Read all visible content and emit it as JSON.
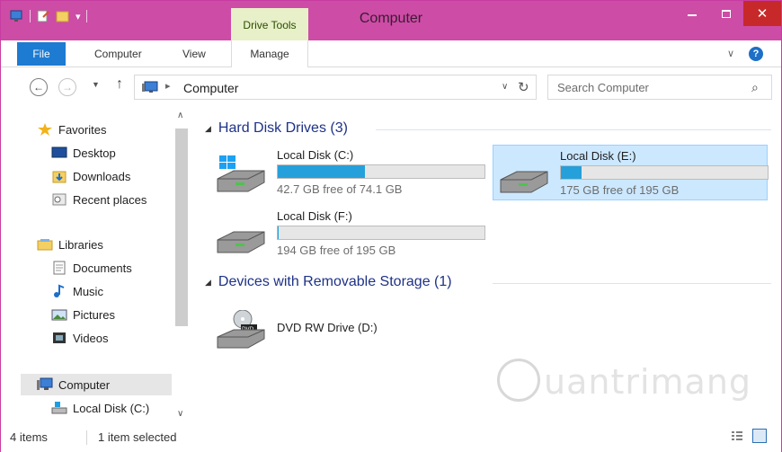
{
  "window": {
    "title": "Computer",
    "contextual_tab_group": "Drive Tools"
  },
  "ribbon": {
    "tabs": [
      "File",
      "Computer",
      "View",
      "Manage"
    ]
  },
  "address": {
    "path": "Computer",
    "search_placeholder": "Search Computer"
  },
  "sidebar": {
    "favorites": {
      "label": "Favorites",
      "items": [
        "Desktop",
        "Downloads",
        "Recent places"
      ]
    },
    "libraries": {
      "label": "Libraries",
      "items": [
        "Documents",
        "Music",
        "Pictures",
        "Videos"
      ]
    },
    "computer": {
      "label": "Computer",
      "items": [
        "Local Disk (C:)"
      ]
    }
  },
  "content": {
    "groups": [
      {
        "title": "Hard Disk Drives (3)",
        "drives": [
          {
            "name": "Local Disk (C:)",
            "free_text": "42.7 GB free of 74.1 GB",
            "used_fraction": 0.42,
            "selected": false
          },
          {
            "name": "Local Disk (E:)",
            "free_text": "175 GB free of 195 GB",
            "used_fraction": 0.1,
            "selected": true
          },
          {
            "name": "Local Disk (F:)",
            "free_text": "194 GB free of 195 GB",
            "used_fraction": 0.005,
            "selected": false
          }
        ]
      },
      {
        "title": "Devices with Removable Storage (1)",
        "drives": [
          {
            "name": "DVD RW Drive (D:)"
          }
        ]
      }
    ]
  },
  "watermark": {
    "text": "uantrimang"
  },
  "status": {
    "item_count": "4 items",
    "selection": "1 item selected"
  },
  "colors": {
    "titlebar": "#cd4ca6",
    "file_tab": "#1d7bd1",
    "close_button": "#c7292a",
    "drive_bar_fill": "#26a0da",
    "selection": "#cce8ff",
    "group_header": "#1e3287"
  }
}
